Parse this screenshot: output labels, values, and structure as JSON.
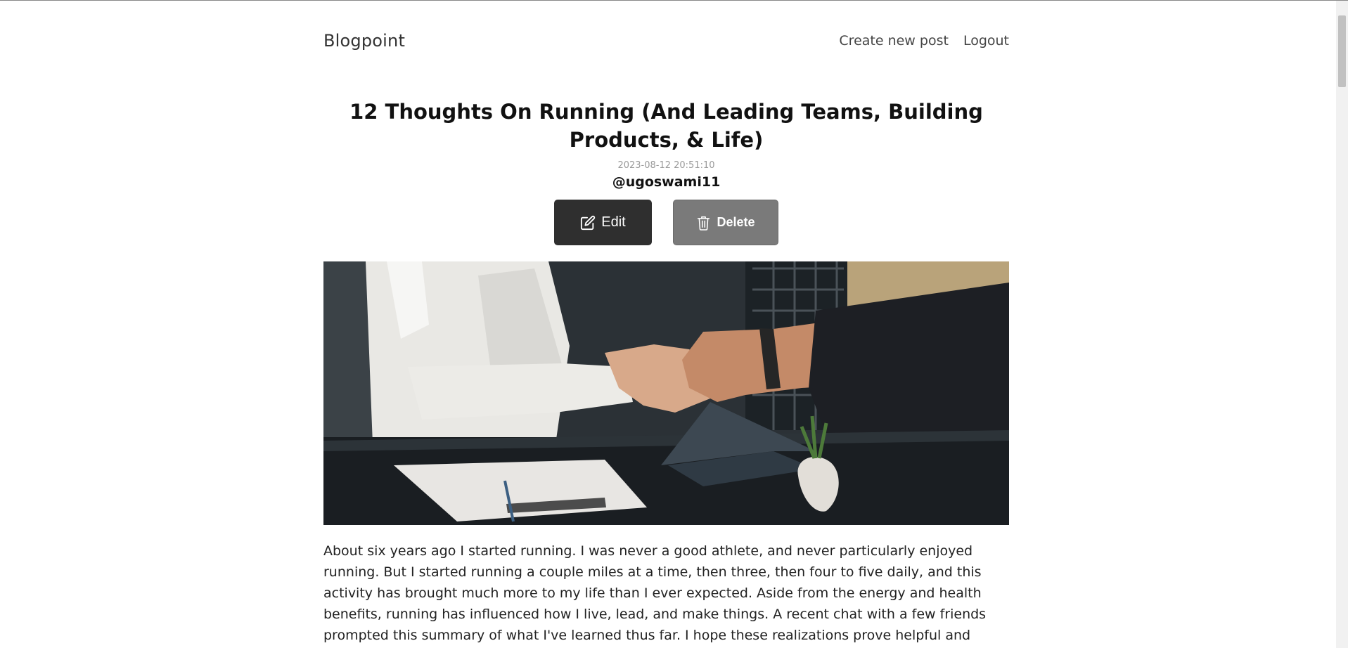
{
  "navbar": {
    "brand": "Blogpoint",
    "links": [
      {
        "label": "Create new post"
      },
      {
        "label": "Logout"
      }
    ]
  },
  "post": {
    "title": "12 Thoughts On Running (And Leading Teams, Building Products, & Life)",
    "date": "2023-08-12 20:51:10",
    "author": "@ugoswami11",
    "actions": {
      "edit_label": "Edit",
      "delete_label": "Delete"
    },
    "image": {
      "icon": "photo-handshake"
    },
    "body": "About six years ago I started running. I was never a good athlete, and never particularly enjoyed running. But I started running a couple miles at a time, then three, then four to five daily, and this activity has brought much more to my life than I ever expected. Aside from the energy and health benefits, running has influenced how I live, lead, and make things. A recent chat with a few friends prompted this summary of what I've learned thus far. I hope these realizations prove helpful and perhaps encourage you...to run, whatever your running"
  },
  "colors": {
    "edit_button": "#2f2f2f",
    "delete_button": "#7a7a7a"
  }
}
